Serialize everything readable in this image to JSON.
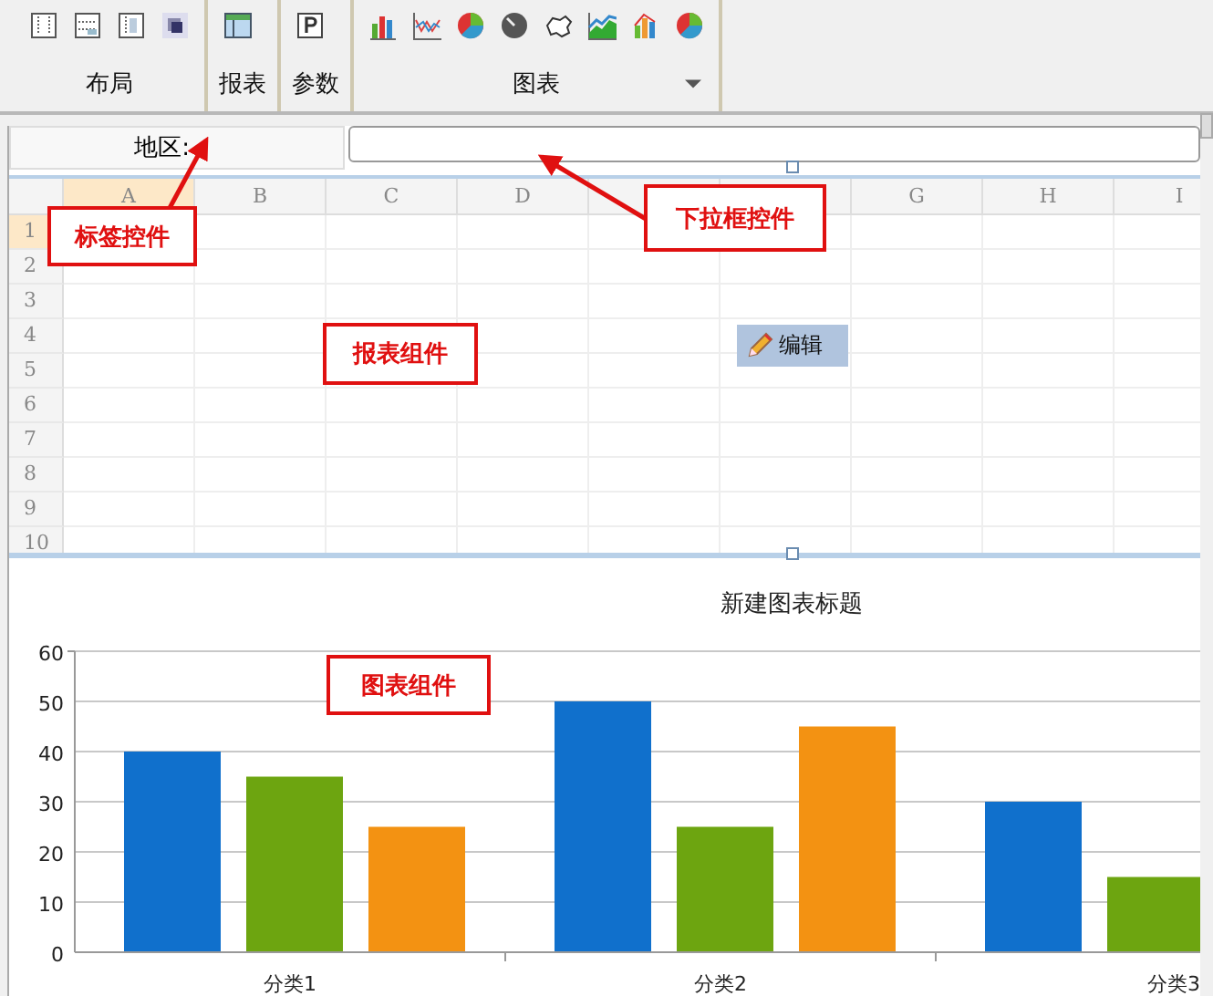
{
  "toolbar": {
    "groups": [
      {
        "label": "布局",
        "tools": [
          {
            "kind": "layout-a"
          },
          {
            "kind": "layout-b"
          },
          {
            "kind": "layout-c"
          },
          {
            "kind": "layer"
          }
        ]
      },
      {
        "label": "报表",
        "tools": [
          {
            "kind": "table"
          }
        ]
      },
      {
        "label": "参数",
        "tools": [
          {
            "kind": "param"
          }
        ]
      },
      {
        "label": "图表",
        "tools": [
          {
            "kind": "bar"
          },
          {
            "kind": "line"
          },
          {
            "kind": "pie"
          },
          {
            "kind": "gauge"
          },
          {
            "kind": "map"
          },
          {
            "kind": "area"
          },
          {
            "kind": "combo"
          },
          {
            "kind": "pie"
          }
        ],
        "dropdown": true
      }
    ]
  },
  "parameter": {
    "label": "地区:"
  },
  "sheet": {
    "columns": [
      {
        "label": "A",
        "selected": true
      },
      {
        "label": "B",
        "selected": false
      },
      {
        "label": "C",
        "selected": false
      },
      {
        "label": "D",
        "selected": false
      },
      {
        "selected": false
      },
      {
        "selected": false
      },
      {
        "label": "G",
        "selected": false
      },
      {
        "label": "H",
        "selected": false
      },
      {
        "label": "I",
        "selected": false
      }
    ],
    "rows": [
      {
        "label": "1",
        "selected": true
      },
      {
        "label": "2",
        "selected": false
      },
      {
        "label": "3",
        "selected": false
      },
      {
        "label": "4",
        "selected": false
      },
      {
        "label": "5",
        "selected": false
      },
      {
        "label": "6",
        "selected": false
      },
      {
        "label": "7",
        "selected": false
      },
      {
        "label": "8",
        "selected": false
      },
      {
        "label": "9",
        "selected": false
      },
      {
        "label": "10",
        "selected": false
      }
    ],
    "edit_button": "编辑"
  },
  "chart": {
    "chart_data": {
      "type": "bar",
      "title": "新建图表标题",
      "categories": [
        "分类1",
        "分类2",
        "分类3"
      ],
      "series": [
        {
          "color": "#1070cc",
          "values": [
            40,
            50,
            30
          ]
        },
        {
          "color": "#6da510",
          "values": [
            35,
            25,
            15
          ]
        },
        {
          "color": "#f39212",
          "values": [
            25,
            45,
            null
          ]
        }
      ],
      "grid": true,
      "ylim": [
        0,
        60
      ],
      "yticks": [
        0,
        10,
        20,
        30,
        40,
        50,
        60
      ]
    }
  },
  "annotations": [
    {
      "text": "标签控件",
      "arrow": true
    },
    {
      "text": "下拉框控件",
      "arrow": true
    },
    {
      "text": "报表组件",
      "arrow": false
    },
    {
      "text": "图表组件",
      "arrow": false
    }
  ]
}
